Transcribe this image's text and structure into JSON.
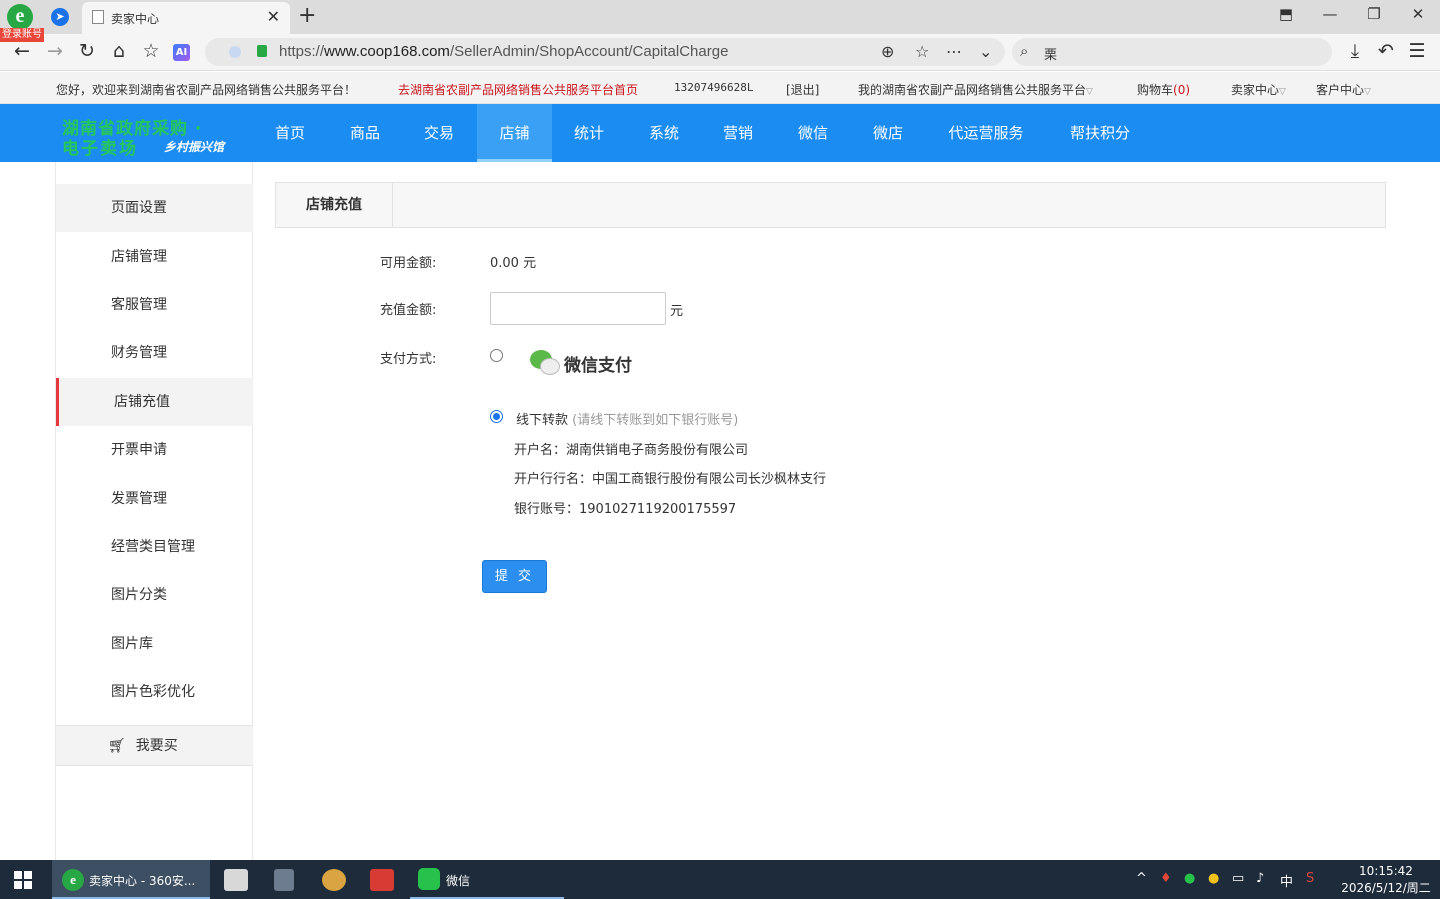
{
  "browser": {
    "tab_title": "卖家中心",
    "login_badge": "登录账号",
    "url_prefix": "https://",
    "url_host": "www.coop168.com",
    "url_path": "/SellerAdmin/ShopAccount/CapitalCharge",
    "search_query": "栗"
  },
  "site_top": {
    "welcome": "您好，欢迎来到湖南省农副产品网络销售公共服务平台！",
    "home_link": "去湖南省农副产品网络销售公共服务平台首页",
    "account": "13207496628L",
    "logout": "[退出]",
    "my_platform": "我的湖南省农副产品网络销售公共服务平台",
    "cart": "购物车",
    "cart_count": "(0)",
    "seller_center": "卖家中心",
    "customer_center": "客户中心"
  },
  "brand": {
    "line1": "湖南省政府采购 ·",
    "line2": "电子卖场",
    "line2_sub": "乡村振兴馆"
  },
  "nav": {
    "items": [
      "首页",
      "商品",
      "交易",
      "店铺",
      "统计",
      "系统",
      "营销",
      "微信",
      "微店",
      "代运营服务",
      "帮扶积分"
    ],
    "active": "店铺"
  },
  "sidebar": {
    "items": [
      "页面设置",
      "店铺管理",
      "客服管理",
      "财务管理",
      "店铺充值",
      "开票申请",
      "发票管理",
      "经营类目管理",
      "图片分类",
      "图片库",
      "图片色彩优化"
    ],
    "active": "店铺充值",
    "buy_label": "我要买"
  },
  "content": {
    "tab_title": "店铺充值",
    "available_label": "可用金额:",
    "available_value": "0.00 元",
    "charge_label": "充值金额:",
    "charge_value": "",
    "charge_unit": "元",
    "pay_label": "支付方式:",
    "wechat_pay": "微信支付",
    "offline_label": "线下转款",
    "offline_hint": "(请线下转账到如下银行账号)",
    "account_name": "开户名：湖南供销电子商务股份有限公司",
    "bank_name": "开户行行名：中国工商银行股份有限公司长沙枫林支行",
    "bank_account": "银行账号：1901027119200175597",
    "submit": "提 交",
    "selected_payment": "offline"
  },
  "taskbar": {
    "active_app": "卖家中心 - 360安...",
    "wechat": "微信",
    "ime": "中",
    "time": "10:15:42",
    "date": "2026/5/12/周二"
  }
}
